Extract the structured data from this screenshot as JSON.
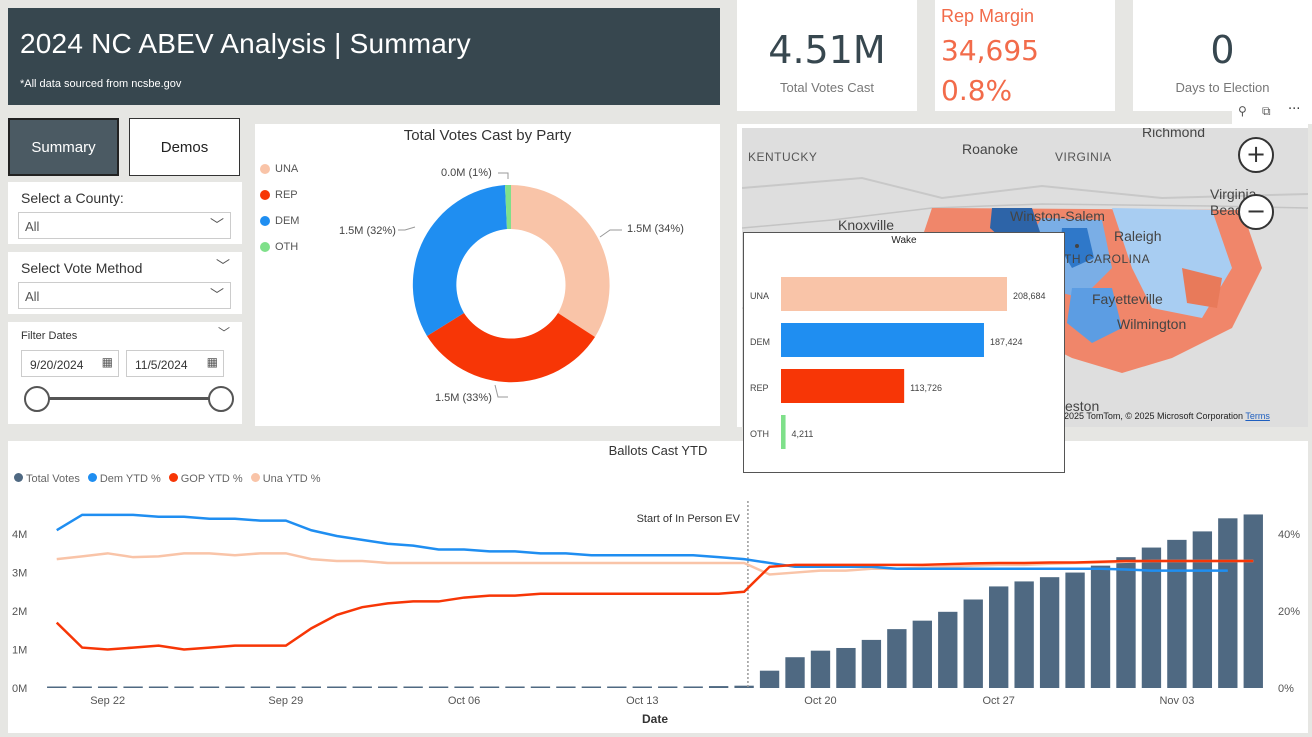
{
  "header": {
    "title": "2024 NC ABEV Analysis | Summary",
    "subtitle": "*All data sourced from ncsbe.gov"
  },
  "kpis": {
    "total_votes": {
      "value": "4.51M",
      "label": "Total Votes Cast"
    },
    "rep_margin": {
      "label": "Rep Margin",
      "value": "34,695",
      "pct": "0.8%"
    },
    "days": {
      "value": "0",
      "label": "Days to Election"
    }
  },
  "nav": {
    "summary": "Summary",
    "demos": "Demos"
  },
  "filters": {
    "county_label": "Select a County:",
    "county_value": "All",
    "method_label": "Select Vote Method",
    "method_value": "All",
    "dates_label": "Filter Dates",
    "date_start": "9/20/2024",
    "date_end": "11/5/2024"
  },
  "colors": {
    "una": "#f9c4a8",
    "rep": "#f73606",
    "dem": "#1f8ef1",
    "oth": "#7fe08a",
    "total": "#4f6982",
    "header": "#37474f"
  },
  "donut": {
    "title": "Total Votes Cast by Party",
    "legend": [
      {
        "key": "una",
        "label": "UNA"
      },
      {
        "key": "rep",
        "label": "REP"
      },
      {
        "key": "dem",
        "label": "DEM"
      },
      {
        "key": "oth",
        "label": "OTH"
      }
    ],
    "labels": {
      "una": "1.5M (34%)",
      "rep": "1.5M (33%)",
      "dem": "1.5M (32%)",
      "oth": "0.0M (1%)"
    }
  },
  "map": {
    "places": [
      "KENTUCKY",
      "Roanoke",
      "VIRGINIA",
      "Richmond",
      "Knoxville",
      "Winston-Salem",
      "Raleigh",
      "Virginia Beach",
      "TH CAROLINA",
      "Fayetteville",
      "Wilmington",
      "eston"
    ],
    "attribution": "2025 TomTom, © 2025 Microsoft Corporation",
    "terms": "Terms",
    "zoom_in": "+",
    "zoom_out": "−",
    "more": "···"
  },
  "tooltip": {
    "title": "Wake",
    "bars": [
      {
        "label": "UNA",
        "value": 208684,
        "text": "208,684",
        "key": "una"
      },
      {
        "label": "DEM",
        "value": 187424,
        "text": "187,424",
        "key": "dem"
      },
      {
        "label": "REP",
        "value": 113726,
        "text": "113,726",
        "key": "rep"
      },
      {
        "label": "OTH",
        "value": 4211,
        "text": "4,211",
        "key": "oth"
      }
    ]
  },
  "chart_data": {
    "type": "bar",
    "title": "Ballots Cast YTD",
    "xlabel": "Date",
    "legend": [
      "Total Votes",
      "Dem YTD %",
      "GOP YTD %",
      "Una YTD %"
    ],
    "x_ticks": [
      "Sep 22",
      "Sep 29",
      "Oct 06",
      "Oct 13",
      "Oct 20",
      "Oct 27",
      "Nov 03"
    ],
    "y_left_ticks": [
      "0M",
      "1M",
      "2M",
      "3M",
      "4M"
    ],
    "y_right_ticks": [
      "0%",
      "20%",
      "40%"
    ],
    "y_left_lim": [
      0,
      4.6
    ],
    "y_right_lim": [
      0,
      46
    ],
    "annotation": "Start of In Person EV",
    "annotation_date_index": 27.5,
    "dates_start": "Sep 20",
    "total_votes_M": [
      0.01,
      0.01,
      0.01,
      0.01,
      0.01,
      0.01,
      0.01,
      0.01,
      0.01,
      0.01,
      0.01,
      0.01,
      0.01,
      0.01,
      0.01,
      0.02,
      0.02,
      0.02,
      0.02,
      0.02,
      0.02,
      0.03,
      0.03,
      0.03,
      0.04,
      0.04,
      0.05,
      0.06,
      0.45,
      0.8,
      0.97,
      1.04,
      1.25,
      1.53,
      1.75,
      1.98,
      2.3,
      2.64,
      2.77,
      2.88,
      3.0,
      3.18,
      3.4,
      3.65,
      3.85,
      4.07,
      4.41,
      4.51
    ],
    "dem_pct": [
      41,
      45,
      45,
      45,
      44.5,
      44.5,
      44,
      44,
      43.5,
      43.5,
      41,
      39.5,
      38.5,
      37.5,
      37,
      36,
      36,
      35.5,
      35.5,
      35,
      35,
      34.5,
      34.5,
      34.5,
      34.5,
      34.5,
      34,
      33.5,
      32.5,
      31.5,
      31.5,
      31.5,
      31.5,
      31,
      31,
      31,
      31,
      31,
      31,
      31,
      31,
      31,
      30.8,
      30.5,
      30.5,
      30.5,
      30.5
    ],
    "rep_pct": [
      17,
      10.5,
      10,
      10.5,
      11,
      10,
      10.5,
      11,
      11,
      11,
      15.5,
      19,
      21,
      22,
      22.5,
      22.5,
      23.5,
      24,
      24,
      24.5,
      24.5,
      24.5,
      24.5,
      24.5,
      24.5,
      24.5,
      24.5,
      25,
      31.5,
      32,
      32,
      32,
      32,
      32,
      32,
      32.2,
      32.4,
      32.5,
      32.5,
      32.6,
      32.6,
      32.8,
      33,
      33,
      33,
      33,
      33,
      33
    ],
    "una_pct": [
      33.5,
      34.2,
      35,
      34,
      34.2,
      35,
      35,
      34.5,
      35,
      35,
      33.5,
      33,
      33,
      32.5,
      32.5,
      32.5,
      32.5,
      32.5,
      32.5,
      32.5,
      32.5,
      32.5,
      32.5,
      32.5,
      32.5,
      32.5,
      32.5,
      32.5,
      29.5,
      30,
      30.5,
      30.5,
      31,
      31,
      31.3,
      31.5,
      31.8,
      32,
      32,
      32.3,
      32.5,
      32.6,
      32.8,
      33,
      33,
      33,
      33,
      33
    ]
  }
}
